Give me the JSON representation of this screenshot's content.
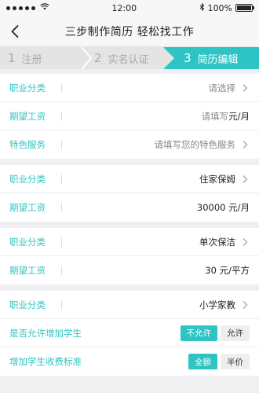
{
  "status": {
    "time": "12:00",
    "battery": "100%"
  },
  "nav": {
    "title": "三步制作简历 轻松找工作"
  },
  "steps": [
    {
      "num": "1",
      "label": "注册"
    },
    {
      "num": "2",
      "label": "实名认证"
    },
    {
      "num": "3",
      "label": "简历编辑"
    }
  ],
  "card1": {
    "category": {
      "label": "职业分类",
      "value": "请选择"
    },
    "salary": {
      "label": "期望工资",
      "value": "请填写",
      "unit": "元/月"
    },
    "special": {
      "label": "特色服务",
      "value": "请填写您的特色服务"
    }
  },
  "card2": {
    "category": {
      "label": "职业分类",
      "value": "住家保姆"
    },
    "salary": {
      "label": "期望工资",
      "value": "30000 元/月"
    }
  },
  "card3": {
    "category": {
      "label": "职业分类",
      "value": "单次保洁"
    },
    "salary": {
      "label": "期望工资",
      "value": "30 元/平方"
    }
  },
  "card4": {
    "category": {
      "label": "职业分类",
      "value": "小学家教"
    },
    "allow_more": {
      "label": "是否允许增加学生",
      "opt_no": "不允许",
      "opt_yes": "允许"
    },
    "fee_standard": {
      "label": "增加学生收费标准",
      "opt_full": "全额",
      "opt_half": "半价"
    }
  },
  "colors": {
    "accent": "#2ec4c4"
  },
  "icons": {
    "back": "back-chevron-icon",
    "row_arrow": "chevron-right-icon"
  }
}
